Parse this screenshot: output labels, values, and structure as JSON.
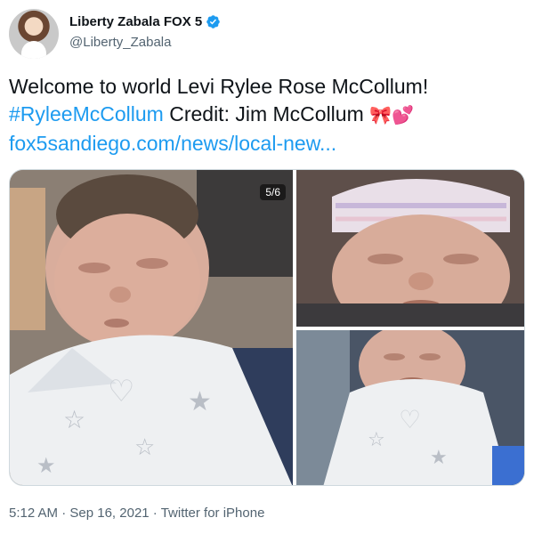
{
  "author": {
    "display_name": "Liberty Zabala FOX 5",
    "handle": "@Liberty_Zabala",
    "verified": true,
    "avatar_icon": "profile-photo"
  },
  "tweet": {
    "line1": "Welcome to world Levi Rylee Rose McCollum!",
    "hashtag": "#RyleeMcCollum",
    "credit": " Credit: Jim McCollum ",
    "emoji": "🎀💕",
    "link": "fox5sandiego.com/news/local-new..."
  },
  "media": {
    "counter": "5/6",
    "photos": [
      {
        "name": "newborn-swaddled-star-blanket"
      },
      {
        "name": "newborn-striped-hat"
      },
      {
        "name": "newborn-swaddled-closeup"
      }
    ]
  },
  "footer": {
    "time": "5:12 AM",
    "separator": " · ",
    "date": "Sep 16, 2021",
    "source": "Twitter for iPhone"
  },
  "colors": {
    "link": "#1d9bf0",
    "text": "#0f1419",
    "secondary": "#536471"
  }
}
